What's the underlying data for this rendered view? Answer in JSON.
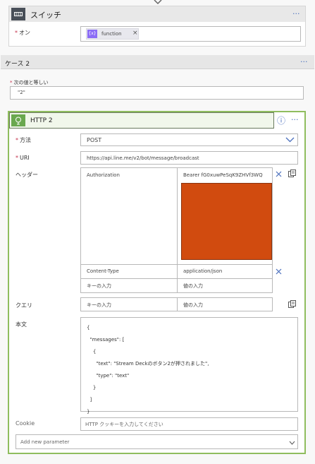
{
  "switch_card": {
    "title": "スイッチ",
    "on_label": "オン",
    "token_label": "function",
    "token_icon": "{x}",
    "token_remove": "×",
    "more": "···"
  },
  "case_card": {
    "title": "ケース 2",
    "equals_label": "次の値と等しい",
    "equals_value": "\"2\"",
    "more": "···"
  },
  "http_card": {
    "title": "HTTP 2",
    "more": "···",
    "info_icon": "ⓘ",
    "method_label": "方法",
    "method_value": "POST",
    "uri_label": "URI",
    "uri_value": "https://api.line.me/v2/bot/message/broadcast",
    "headers_label": "ヘッダー",
    "headers": [
      {
        "key": "Authorization",
        "value": "Bearer fG0xuwPeSqK9ZHVf3WQ"
      },
      {
        "key": "Content-Type",
        "value": "application/json"
      },
      {
        "key": "キーの入力",
        "value": "値の入力"
      }
    ],
    "query_label": "クエリ",
    "query_key_placeholder": "キーの入力",
    "query_value_placeholder": "値の入力",
    "body_label": "本文",
    "body_lines": [
      "{",
      "  \"messages\": [",
      "    {",
      "      \"text\": \"Stream Deckのボタン2が押されました\",",
      "      \"type\": \"text\"",
      "    }",
      "  ]",
      "}"
    ],
    "cookie_label": "Cookie",
    "cookie_placeholder": "HTTP クッキーを入力してください",
    "add_param_label": "Add new parameter"
  },
  "colors": {
    "switch_header": "#e8e8e8",
    "switch_icon_bg": "#484f58",
    "http_border": "#8fbd5e",
    "http_icon_bg": "#6aa84f",
    "redaction": "#d14b0f",
    "token_icon_bg": "#8b6cf6",
    "link_blue": "#4a6fbd"
  }
}
